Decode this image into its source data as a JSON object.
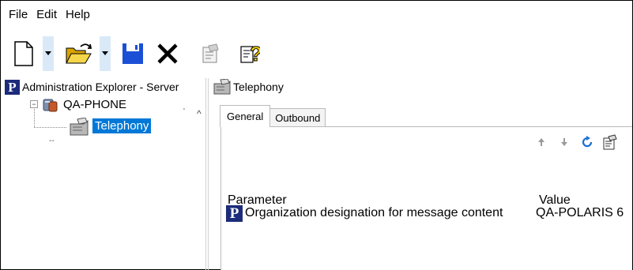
{
  "menu": {
    "file": "File",
    "edit": "Edit",
    "help": "Help"
  },
  "toolbar": {
    "icons": [
      "new-document-icon",
      "chevron-down-icon",
      "open-folder-icon",
      "chevron-down-icon",
      "save-icon",
      "delete-icon",
      "properties-icon",
      "help-icon"
    ]
  },
  "explorer": {
    "title": "Administration Explorer - Server",
    "logo": "P",
    "tree": [
      {
        "label": "QA-PHONE",
        "expander": "−"
      },
      {
        "label": "Telephony",
        "selected": true
      }
    ]
  },
  "detail": {
    "title": "Telephony",
    "tabs": [
      {
        "label": "General",
        "active": true
      },
      {
        "label": "Outbound",
        "active": false
      }
    ],
    "actions": [
      "arrow-up-icon",
      "arrow-down-icon",
      "refresh-icon",
      "properties-icon"
    ],
    "columns": {
      "parameter": "Parameter",
      "value": "Value"
    },
    "rows": [
      {
        "logo": "P",
        "parameter": "Organization designation for message content",
        "value": "QA-POLARIS 6"
      }
    ]
  },
  "colors": {
    "selection": "#0078d7",
    "toolbar_highlight": "#d9e9f7",
    "logo": "#1c2b7a"
  }
}
